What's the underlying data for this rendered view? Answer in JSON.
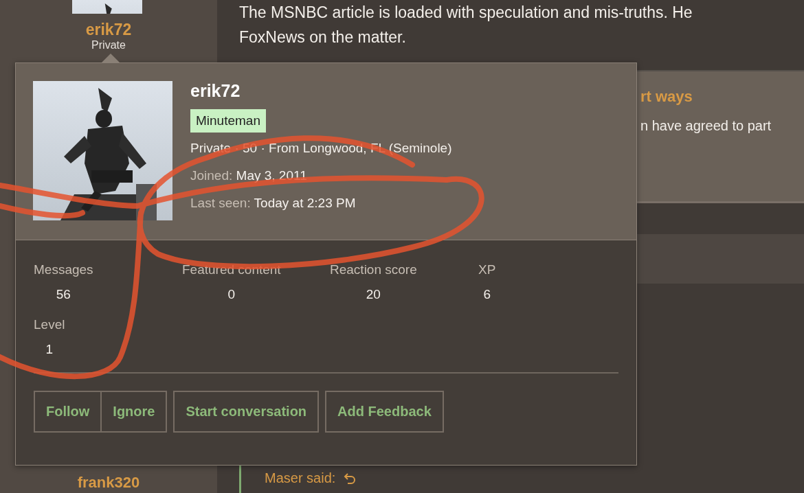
{
  "thread": {
    "top_author": {
      "name": "erik72",
      "title": "Private"
    },
    "post_lines": [
      "The MSNBC article is loaded with speculation and mis-truths. He",
      "FoxNews on the matter."
    ],
    "card": {
      "title": "rt ways",
      "text": "n have agreed to part"
    },
    "bottom_author": {
      "name": "frank320"
    },
    "quote": {
      "author": "Maser said:"
    }
  },
  "member_card": {
    "name": "erik72",
    "banner": "Minuteman",
    "details": "Private · 50 · From Longwood, FL (Seminole)",
    "joined": {
      "label": "Joined:",
      "value": "May 3, 2011"
    },
    "last_seen": {
      "label": "Last seen:",
      "value": "Today at 2:23 PM"
    },
    "stats": [
      {
        "label": "Messages",
        "value": "56"
      },
      {
        "label": "Featured content",
        "value": "0"
      },
      {
        "label": "Reaction score",
        "value": "20"
      },
      {
        "label": "XP",
        "value": "6"
      },
      {
        "label": "Level",
        "value": "1"
      }
    ],
    "button_groups": [
      [
        {
          "label": "Follow"
        },
        {
          "label": "Ignore"
        }
      ],
      [
        {
          "label": "Start conversation"
        }
      ],
      [
        {
          "label": "Add Feedback"
        }
      ]
    ]
  }
}
